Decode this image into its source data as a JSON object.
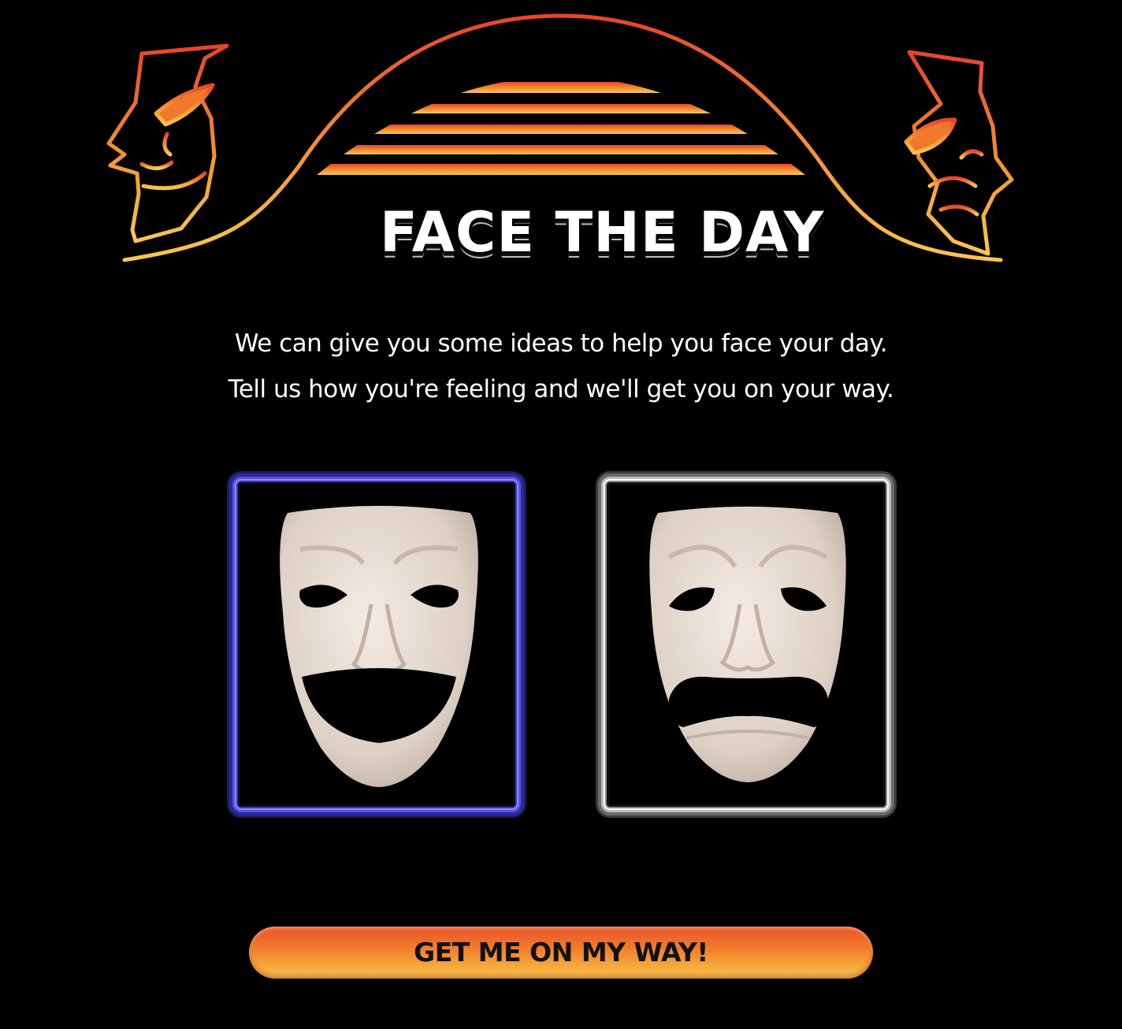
{
  "header": {
    "logo_title": "FACE THE DAY"
  },
  "intro": {
    "line_1": "We can give you some ideas to help you face your day.",
    "line_2": "Tell us how you're feeling and we'll get you on your way."
  },
  "moods": [
    {
      "icon": "comedy-mask-icon",
      "selected": true
    },
    {
      "icon": "tragedy-mask-icon",
      "selected": false
    }
  ],
  "cta": {
    "label": "GET ME ON MY WAY!"
  },
  "colors": {
    "background": "#000000",
    "accent_orange": "#e9522a",
    "accent_yellow": "#f8c455",
    "selected_border": "#5752e0",
    "unselected_border": "#ffffff",
    "mask_face": "#e8ddd3"
  }
}
